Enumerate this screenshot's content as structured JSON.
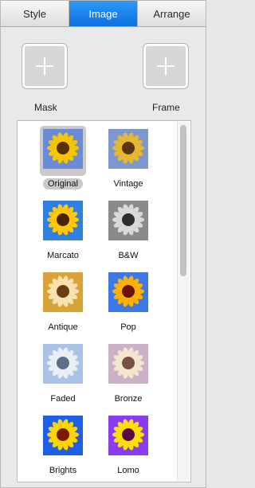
{
  "tabs": [
    {
      "label": "Style",
      "active": false
    },
    {
      "label": "Image",
      "active": true
    },
    {
      "label": "Arrange",
      "active": false
    }
  ],
  "mask": {
    "label": "Mask",
    "icon": "plus-icon"
  },
  "frame": {
    "label": "Frame",
    "icon": "plus-icon"
  },
  "filters": [
    {
      "label": "Original",
      "selected": true,
      "sky": "#6a8cd6",
      "petal": "#f7c400",
      "center": "#5a3000"
    },
    {
      "label": "Vintage",
      "selected": false,
      "sky": "#7d98cc",
      "petal": "#e6b832",
      "center": "#5b3510"
    },
    {
      "label": "Marcato",
      "selected": false,
      "sky": "#2f80e0",
      "petal": "#ffc800",
      "center": "#4a2400"
    },
    {
      "label": "B&W",
      "selected": false,
      "sky": "#8a8a8a",
      "petal": "#d9d9d9",
      "center": "#2e2e2e"
    },
    {
      "label": "Antique",
      "selected": false,
      "sky": "#d8a43a",
      "petal": "#f5e2b0",
      "center": "#6a4010"
    },
    {
      "label": "Pop",
      "selected": false,
      "sky": "#3c78e6",
      "petal": "#ffb000",
      "center": "#6a1400"
    },
    {
      "label": "Faded",
      "selected": false,
      "sky": "#a9c2e6",
      "petal": "#e8eef4",
      "center": "#5b6f86"
    },
    {
      "label": "Bronze",
      "selected": false,
      "sky": "#cbb0c8",
      "petal": "#f4e6cc",
      "center": "#7a5040"
    },
    {
      "label": "Brights",
      "selected": false,
      "sky": "#1f5fe6",
      "petal": "#ffd400",
      "center": "#7a1c00"
    },
    {
      "label": "Lomo",
      "selected": false,
      "sky": "#8a3cf0",
      "petal": "#ffe000",
      "center": "#5a0a40"
    }
  ]
}
